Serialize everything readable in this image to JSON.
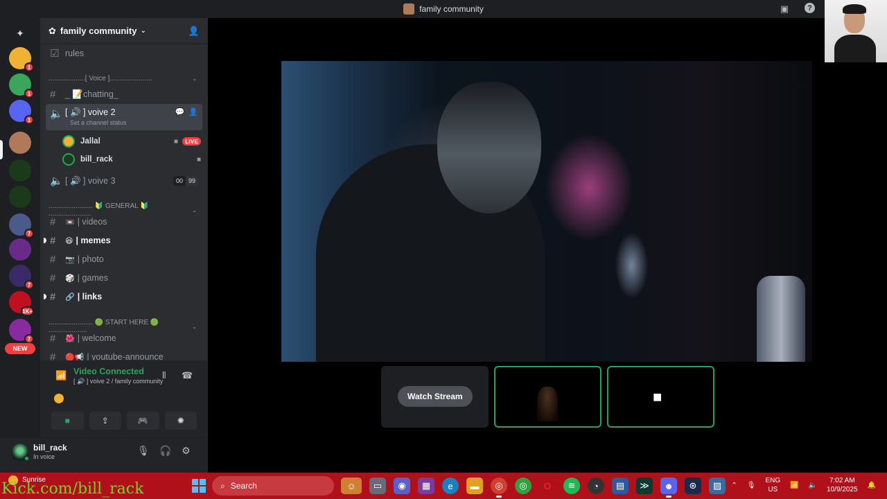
{
  "window": {
    "title": "family community"
  },
  "servers": [
    {
      "name": "server-1",
      "color": "#f0b232",
      "badge": "1"
    },
    {
      "name": "server-2",
      "color": "#3ba55c",
      "badge": "1"
    },
    {
      "name": "discord-server",
      "color": "#5865f2",
      "badge": "1"
    },
    {
      "name": "family-community",
      "color": "#b07a5a",
      "badge": ""
    },
    {
      "name": "server-5",
      "color": "#1a3a1a",
      "badge": ""
    },
    {
      "name": "server-6",
      "color": "#1a3a1a",
      "badge": ""
    },
    {
      "name": "server-7",
      "color": "#4a5a8a",
      "badge": "7"
    },
    {
      "name": "server-8",
      "color": "#6a2a8a",
      "badge": ""
    },
    {
      "name": "server-9",
      "color": "#3a2a6a",
      "badge": "7"
    },
    {
      "name": "server-10",
      "color": "#c01020",
      "badge": "1K+"
    },
    {
      "name": "server-11",
      "color": "#8a2aa0",
      "badge": "7"
    }
  ],
  "server_new_label": "NEW",
  "guild": {
    "name": "family community"
  },
  "channels": {
    "rules": "rules",
    "voice_category": "...................[ Voice ]......................",
    "chatting": "_ 📝chatting_",
    "voive2": "[ 🔊 ] voive 2",
    "voive2_status": "Set a channel status",
    "voive3": "[ 🔊 ] voive 3",
    "voive3_count_a": "00",
    "voive3_count_b": "99",
    "general_category": "....................... 🔰 GENERAL 🔰 ......................",
    "videos": "| videos",
    "memes": "| memes",
    "photo": "| photo",
    "games": "| games",
    "links": "| links",
    "start_category": "....................... 🟢 START HERE 🟢 ....................",
    "welcome": "| welcome",
    "youtube": "| youtube-announce"
  },
  "voice_users": [
    {
      "name": "Jallal",
      "live": "LIVE"
    },
    {
      "name": "bill_rack",
      "live": ""
    }
  ],
  "voice_panel": {
    "title": "Video Connected",
    "subtitle": "[ 🔊 ] voive 2 / family community"
  },
  "user": {
    "name": "bill_rack",
    "status": "In voice"
  },
  "stage": {
    "watch_label": "Watch Stream"
  },
  "taskbar": {
    "weather_title": "Sunrise",
    "search": "Search",
    "lang_top": "ENG",
    "lang_bottom": "US",
    "time": "7:02 AM",
    "date": "10/9/2025"
  },
  "overlay": {
    "kick_text": "Kick.com/bill_rack"
  }
}
